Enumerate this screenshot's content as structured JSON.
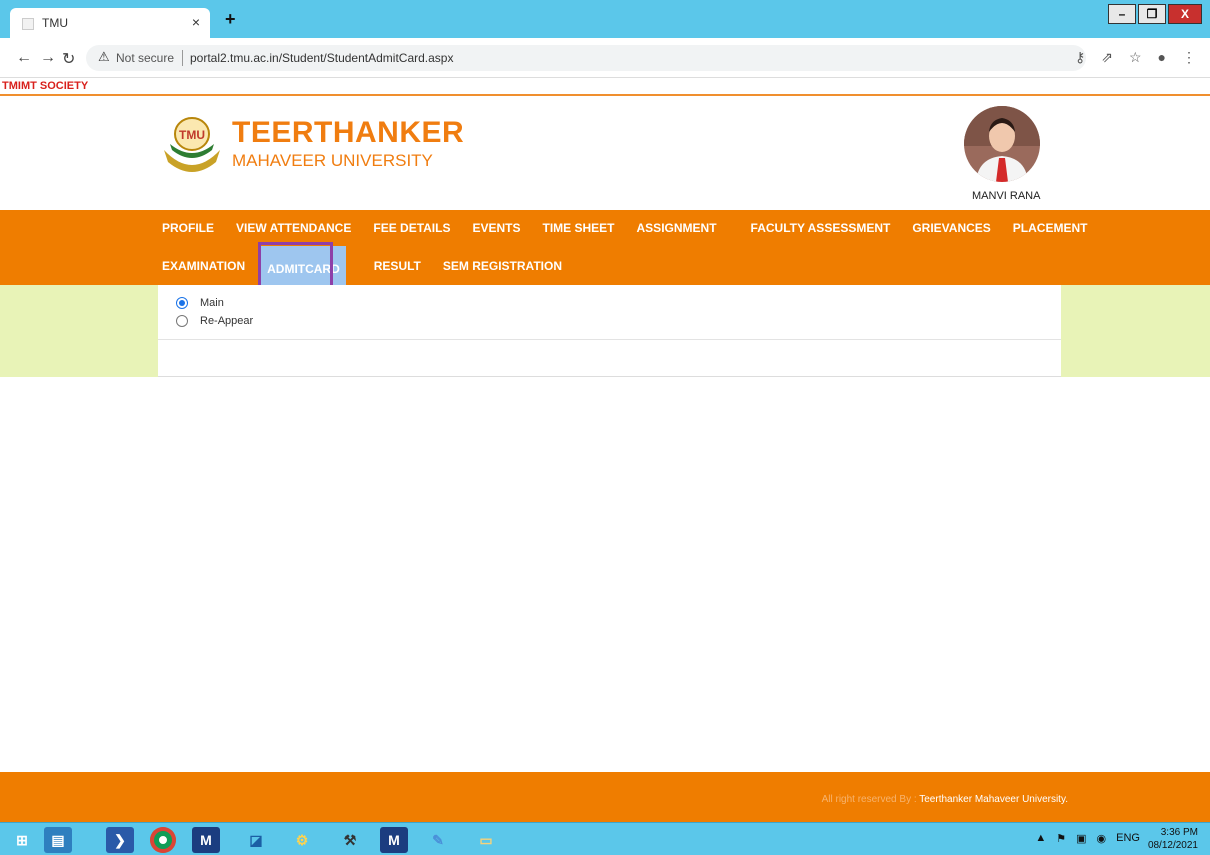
{
  "browser": {
    "tab_title": "TMU",
    "tab_close": "×",
    "new_tab": "+",
    "security_label": "Not secure",
    "url": "portal2.tmu.ac.in/Student/StudentAdmitCard.aspx",
    "window_controls": {
      "minimize": "–",
      "restore": "❐",
      "close": "X"
    }
  },
  "page": {
    "society": "TMIMT SOCIETY",
    "brand_line1": "TEERTHANKER",
    "brand_line2": "MAHAVEER UNIVERSITY",
    "logo_text": "TMU",
    "student_name": "MANVI RANA",
    "menu_row1": [
      "PROFILE",
      "VIEW ATTENDANCE",
      "FEE DETAILS",
      "EVENTS",
      "TIME SHEET",
      "ASSIGNMENT",
      "FACULTY ASSESSMENT",
      "GRIEVANCES",
      "PLACEMENT"
    ],
    "menu_row2": [
      "EXAMINATION",
      "ADMITCARD",
      "RESULT",
      "SEM REGISTRATION"
    ],
    "active_menu": "ADMITCARD",
    "radio_main": "Main",
    "radio_reappear": "Re-Appear",
    "selected_radio": "Main",
    "footer_prefix": "All right reserved By : ",
    "footer_org": "Teerthanker Mahaveer University."
  },
  "taskbar": {
    "tray_lang": "ENG",
    "time": "3:36 PM",
    "date": "08/12/2021"
  },
  "colors": {
    "orange": "#ef7d00",
    "tabbar": "#5bc7ea",
    "society_red": "#d8201c",
    "active_menu_bg": "#9ec6ef",
    "highlight": "#8e3fa8",
    "band": "#e8f3b7"
  }
}
